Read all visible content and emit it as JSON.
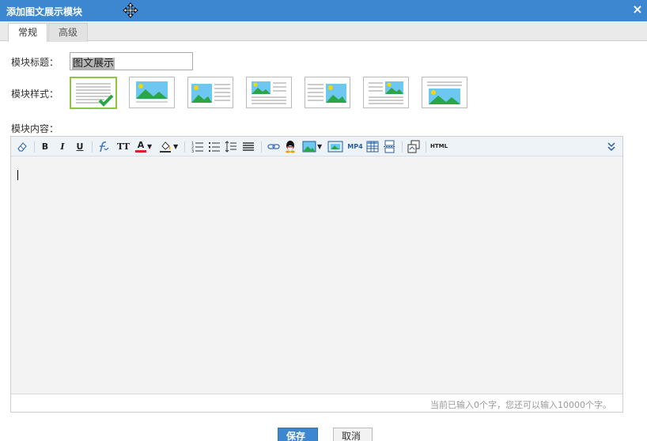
{
  "dialog": {
    "title": "添加图文展示模块",
    "close_label": "×"
  },
  "tabs": [
    {
      "label": "常规",
      "active": true
    },
    {
      "label": "高级",
      "active": false
    }
  ],
  "form": {
    "title_label": "模块标题：",
    "title_value": "图文展示",
    "style_label": "模块样式：",
    "content_label": "模块内容：",
    "selected_style_index": 0,
    "style_options": [
      "text-only",
      "image-left-text-right",
      "image-left-text-right-alt",
      "image-top-text-bottom",
      "text-left-image-right",
      "text-left-image-right-alt",
      "image-center-text-around"
    ]
  },
  "editor": {
    "toolbar": {
      "bold_label": "B",
      "italic_label": "I",
      "underline_label": "U",
      "font_size_label": "TT",
      "font_color_label": "A",
      "mp4_label": "MP4",
      "html_label": "HTML"
    },
    "char_count_text": "当前已输入0个字，您还可以输入10000个字。"
  },
  "buttons": {
    "save_label": "保存",
    "cancel_label": "取消"
  },
  "colors": {
    "title_bar": "#3c87cf",
    "selected_border": "#8dc63f",
    "thumb_sky": "#6cc8f0",
    "thumb_hill": "#2aa648",
    "thumb_sun": "#f5d600"
  }
}
